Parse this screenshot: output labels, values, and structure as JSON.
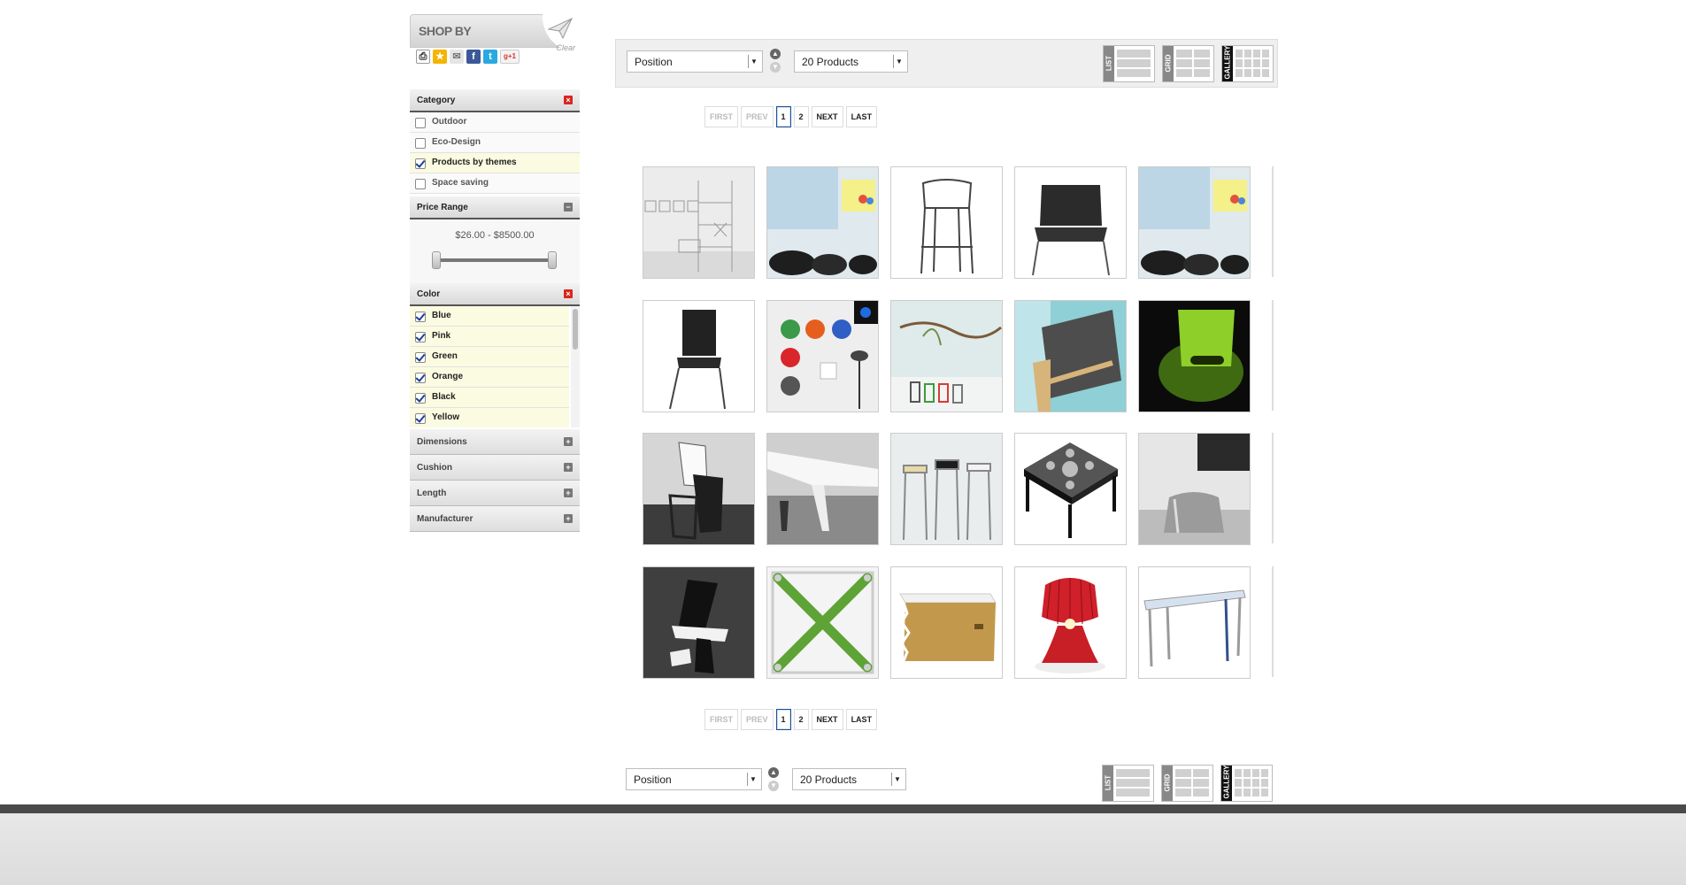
{
  "shop_by": {
    "title": "SHOP BY",
    "clear": "Clear",
    "share_icons": [
      "print-icon",
      "bookmark-star-icon",
      "email-icon",
      "facebook-icon",
      "twitter-icon",
      "google-plus-icon"
    ],
    "google_plus_label": "g+1"
  },
  "category": {
    "title": "Category",
    "options": [
      {
        "label": "Outdoor",
        "checked": false
      },
      {
        "label": "Eco-Design",
        "checked": false
      },
      {
        "label": "Products by themes",
        "checked": true
      },
      {
        "label": "Space saving",
        "checked": false
      }
    ]
  },
  "price": {
    "title": "Price Range",
    "range": "$26.00 - $8500.00",
    "min": 26.0,
    "max": 8500.0
  },
  "color": {
    "title": "Color",
    "options": [
      {
        "label": "Blue",
        "checked": true
      },
      {
        "label": "Pink",
        "checked": true
      },
      {
        "label": "Green",
        "checked": true
      },
      {
        "label": "Orange",
        "checked": true
      },
      {
        "label": "Black",
        "checked": true
      },
      {
        "label": "Yellow",
        "checked": true
      }
    ]
  },
  "collapsed_filters": [
    "Dimensions",
    "Cushion",
    "Length",
    "Manufacturer"
  ],
  "toolbar": {
    "sort_by": "Position",
    "per_page": "20 Products",
    "views": [
      "LIST",
      "GRID",
      "GALLERY"
    ],
    "active_view": "GALLERY"
  },
  "pager": {
    "first": "FIRST",
    "prev": "PREV",
    "pages": [
      "1",
      "2"
    ],
    "current": "1",
    "next": "NEXT",
    "last": "LAST"
  },
  "products": [
    "shelf",
    "window-chairs",
    "bar-stool-black",
    "lounge-chair-black",
    "window-chairs",
    "chair-black",
    "wall-lamps",
    "branch-installation",
    "chair-poolside",
    "green-light-chair",
    "rocking-chairs",
    "white-desk",
    "bar-stools",
    "patterned-stool",
    "metal-stool",
    "folded-chair",
    "green-x-table",
    "cardboard-table",
    "red-lamp",
    "blue-table"
  ],
  "colors": {
    "accent_blue": "#1d4f91",
    "close_red": "#d9261c",
    "footer_dark": "#4a4a4a"
  }
}
